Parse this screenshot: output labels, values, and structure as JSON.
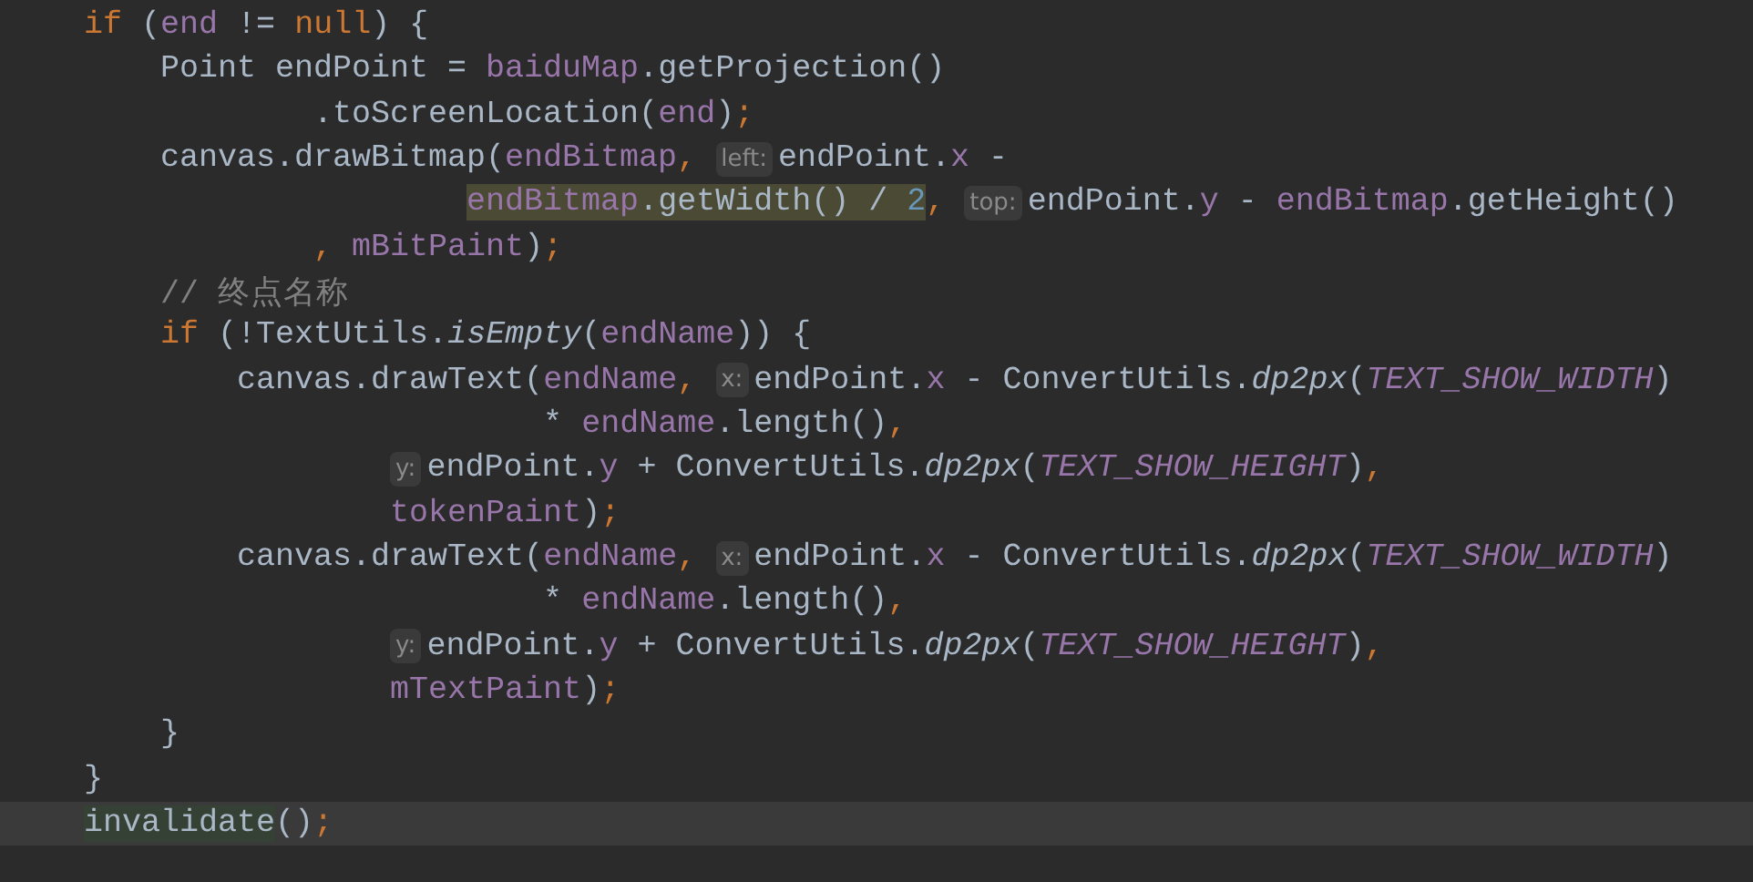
{
  "editor": {
    "lines": [
      {
        "current": false,
        "segments": [
          {
            "kind": "code",
            "tokens": [
              {
                "text": "    if",
                "kind": "keyword"
              },
              {
                "text": " (",
                "kind": "plain"
              },
              {
                "text": "end",
                "kind": "field"
              },
              {
                "text": " != ",
                "kind": "plain"
              },
              {
                "text": "null",
                "kind": "keyword"
              },
              {
                "text": ") {",
                "kind": "plain"
              }
            ]
          }
        ]
      },
      {
        "current": false,
        "segments": [
          {
            "kind": "code",
            "tokens": [
              {
                "text": "        Point endPoint = ",
                "kind": "plain"
              },
              {
                "text": "baiduMap",
                "kind": "field"
              },
              {
                "text": ".getProjection()",
                "kind": "plain"
              }
            ]
          }
        ]
      },
      {
        "current": false,
        "segments": [
          {
            "kind": "code",
            "tokens": [
              {
                "text": "                .toScreenLocation(",
                "kind": "plain"
              },
              {
                "text": "end",
                "kind": "field"
              },
              {
                "text": ")",
                "kind": "plain"
              },
              {
                "text": ";",
                "kind": "punct"
              }
            ]
          }
        ]
      },
      {
        "current": false,
        "segments": [
          {
            "kind": "code",
            "tokens": [
              {
                "text": "        canvas.drawBitmap(",
                "kind": "plain"
              },
              {
                "text": "endBitmap",
                "kind": "field"
              },
              {
                "text": ", ",
                "kind": "punct"
              }
            ]
          },
          {
            "kind": "hint",
            "text": "left:"
          },
          {
            "kind": "code",
            "tokens": [
              {
                "text": "endPoint.",
                "kind": "plain"
              },
              {
                "text": "x",
                "kind": "field"
              },
              {
                "text": " -",
                "kind": "plain"
              }
            ]
          }
        ]
      },
      {
        "current": false,
        "segments": [
          {
            "kind": "code",
            "tokens": [
              {
                "kind": "search-highlight",
                "tokens": [
                  {
                    "text": "                        endBitmap",
                    "kind": "field"
                  },
                  {
                    "text": ".getWidth() / ",
                    "kind": "plain"
                  },
                  {
                    "text": "2",
                    "kind": "number"
                  }
                ]
              },
              {
                "text": ", ",
                "kind": "punct"
              }
            ]
          },
          {
            "kind": "hint",
            "text": "top:"
          },
          {
            "kind": "code",
            "tokens": [
              {
                "text": "endPoint.",
                "kind": "plain"
              },
              {
                "text": "y",
                "kind": "field"
              },
              {
                "text": " - ",
                "kind": "plain"
              },
              {
                "text": "endBitmap",
                "kind": "field"
              },
              {
                "text": ".getHeight()",
                "kind": "plain"
              }
            ]
          }
        ]
      },
      {
        "current": false,
        "segments": [
          {
            "kind": "code",
            "tokens": [
              {
                "text": "                ,",
                "kind": "punct"
              },
              {
                "text": " mBitPaint",
                "kind": "field"
              },
              {
                "text": ")",
                "kind": "plain"
              },
              {
                "text": ";",
                "kind": "punct"
              }
            ]
          }
        ]
      },
      {
        "current": false,
        "segments": [
          {
            "kind": "code",
            "tokens": [
              {
                "text": "        // 终点名称",
                "kind": "comment"
              }
            ]
          }
        ]
      },
      {
        "current": false,
        "segments": [
          {
            "kind": "code",
            "tokens": [
              {
                "text": "        if",
                "kind": "keyword"
              },
              {
                "text": " (!TextUtils.",
                "kind": "plain"
              },
              {
                "text": "isEmpty",
                "kind": "static"
              },
              {
                "text": "(",
                "kind": "plain"
              },
              {
                "text": "endName",
                "kind": "field"
              },
              {
                "text": ")) {",
                "kind": "plain"
              }
            ]
          }
        ]
      },
      {
        "current": false,
        "segments": [
          {
            "kind": "code",
            "tokens": [
              {
                "text": "            canvas.drawText(",
                "kind": "plain"
              },
              {
                "text": "endName",
                "kind": "field"
              },
              {
                "text": ", ",
                "kind": "punct"
              }
            ]
          },
          {
            "kind": "hint",
            "text": "x:"
          },
          {
            "kind": "code",
            "tokens": [
              {
                "text": "endPoint.",
                "kind": "plain"
              },
              {
                "text": "x",
                "kind": "field"
              },
              {
                "text": " - ConvertUtils.",
                "kind": "plain"
              },
              {
                "text": "dp2px",
                "kind": "static"
              },
              {
                "text": "(",
                "kind": "plain"
              },
              {
                "text": "TEXT_SHOW_WIDTH",
                "kind": "constant"
              },
              {
                "text": ")",
                "kind": "plain"
              }
            ]
          }
        ]
      },
      {
        "current": false,
        "segments": [
          {
            "kind": "code",
            "tokens": [
              {
                "text": "                            * ",
                "kind": "plain"
              },
              {
                "text": "endName",
                "kind": "field"
              },
              {
                "text": ".length()",
                "kind": "plain"
              },
              {
                "text": ",",
                "kind": "punct"
              }
            ]
          }
        ]
      },
      {
        "current": false,
        "segments": [
          {
            "kind": "hint",
            "text": "                    y:"
          },
          {
            "kind": "code",
            "tokens": [
              {
                "text": "endPoint.",
                "kind": "plain"
              },
              {
                "text": "y",
                "kind": "field"
              },
              {
                "text": " + ConvertUtils.",
                "kind": "plain"
              },
              {
                "text": "dp2px",
                "kind": "static"
              },
              {
                "text": "(",
                "kind": "plain"
              },
              {
                "text": "TEXT_SHOW_HEIGHT",
                "kind": "constant"
              },
              {
                "text": ")",
                "kind": "plain"
              },
              {
                "text": ",",
                "kind": "punct"
              }
            ]
          }
        ]
      },
      {
        "current": false,
        "segments": [
          {
            "kind": "code",
            "tokens": [
              {
                "text": "                    tokenPaint",
                "kind": "field"
              },
              {
                "text": ")",
                "kind": "plain"
              },
              {
                "text": ";",
                "kind": "punct"
              }
            ]
          }
        ]
      },
      {
        "current": false,
        "segments": [
          {
            "kind": "code",
            "tokens": [
              {
                "text": "            canvas.drawText(",
                "kind": "plain"
              },
              {
                "text": "endName",
                "kind": "field"
              },
              {
                "text": ", ",
                "kind": "punct"
              }
            ]
          },
          {
            "kind": "hint",
            "text": "x:"
          },
          {
            "kind": "code",
            "tokens": [
              {
                "text": "endPoint.",
                "kind": "plain"
              },
              {
                "text": "x",
                "kind": "field"
              },
              {
                "text": " - ConvertUtils.",
                "kind": "plain"
              },
              {
                "text": "dp2px",
                "kind": "static"
              },
              {
                "text": "(",
                "kind": "plain"
              },
              {
                "text": "TEXT_SHOW_WIDTH",
                "kind": "constant"
              },
              {
                "text": ")",
                "kind": "plain"
              }
            ]
          }
        ]
      },
      {
        "current": false,
        "segments": [
          {
            "kind": "code",
            "tokens": [
              {
                "text": "                            * ",
                "kind": "plain"
              },
              {
                "text": "endName",
                "kind": "field"
              },
              {
                "text": ".length()",
                "kind": "plain"
              },
              {
                "text": ",",
                "kind": "punct"
              }
            ]
          }
        ]
      },
      {
        "current": false,
        "segments": [
          {
            "kind": "hint",
            "text": "                    y:"
          },
          {
            "kind": "code",
            "tokens": [
              {
                "text": "endPoint.",
                "kind": "plain"
              },
              {
                "text": "y",
                "kind": "field"
              },
              {
                "text": " + ConvertUtils.",
                "kind": "plain"
              },
              {
                "text": "dp2px",
                "kind": "static"
              },
              {
                "text": "(",
                "kind": "plain"
              },
              {
                "text": "TEXT_SHOW_HEIGHT",
                "kind": "constant"
              },
              {
                "text": ")",
                "kind": "plain"
              },
              {
                "text": ",",
                "kind": "punct"
              }
            ]
          }
        ]
      },
      {
        "current": false,
        "segments": [
          {
            "kind": "code",
            "tokens": [
              {
                "text": "                    mTextPaint",
                "kind": "field"
              },
              {
                "text": ")",
                "kind": "plain"
              },
              {
                "text": ";",
                "kind": "punct"
              }
            ]
          }
        ]
      },
      {
        "current": false,
        "segments": [
          {
            "kind": "code",
            "tokens": [
              {
                "text": "        }",
                "kind": "plain"
              }
            ]
          }
        ]
      },
      {
        "current": false,
        "segments": [
          {
            "kind": "code",
            "tokens": [
              {
                "text": "    }",
                "kind": "plain"
              }
            ]
          }
        ]
      },
      {
        "current": true,
        "segments": [
          {
            "kind": "code",
            "tokens": [
              {
                "kind": "usage-highlight",
                "tokens": [
                  {
                    "text": "    invalidate",
                    "kind": "plain"
                  }
                ]
              },
              {
                "text": "()",
                "kind": "plain"
              },
              {
                "text": ";",
                "kind": "punct"
              }
            ]
          }
        ]
      }
    ]
  }
}
